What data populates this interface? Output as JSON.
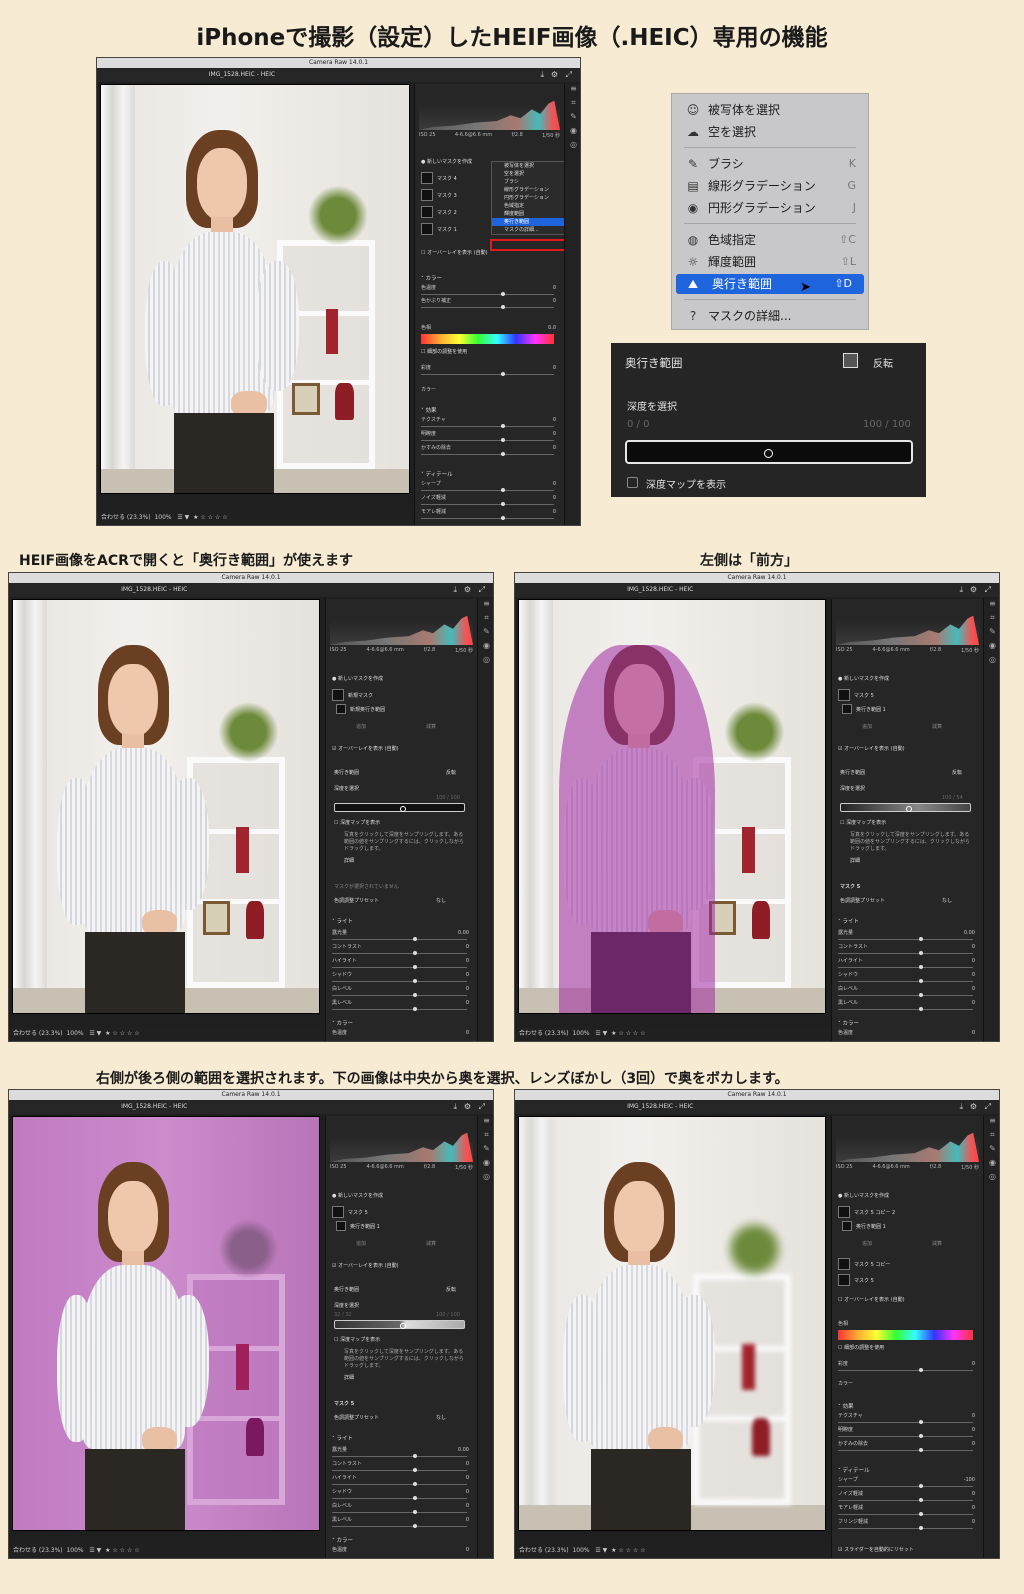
{
  "captions": {
    "title": "iPhoneで撮影（設定）したHEIF画像（.HEIC）専用の機能",
    "left": "HEIF画像をACRで開くと「奥行き範囲」が使えます",
    "right": "左側は「前方」",
    "bottom": "右側が後ろ側の範囲を選択されます。下の画像は中央から奥を選択、レンズぼかし（3回）で奥をボカします。"
  },
  "app": {
    "title": "Camera Raw 14.0.1",
    "filename": "IMG_1528.HEIC  -  HEIC",
    "fit": "合わせる (23.3%)",
    "zoom": "100%"
  },
  "exif": {
    "iso": "ISO 25",
    "lens": "4-6.6@6.6 mm",
    "fstop": "f/2.8",
    "shutter": "1/50 秒"
  },
  "menu": {
    "items": [
      {
        "icon": "person-icon",
        "label": "被写体を選択",
        "shortcut": ""
      },
      {
        "icon": "sky-icon",
        "label": "空を選択",
        "shortcut": ""
      },
      {
        "icon": "brush-icon",
        "label": "ブラシ",
        "shortcut": "K"
      },
      {
        "icon": "linear-gradient-icon",
        "label": "線形グラデーション",
        "shortcut": "G"
      },
      {
        "icon": "radial-gradient-icon",
        "label": "円形グラデーション",
        "shortcut": "J"
      },
      {
        "icon": "color-range-icon",
        "label": "色域指定",
        "shortcut": "⇧C"
      },
      {
        "icon": "luminance-range-icon",
        "label": "輝度範囲",
        "shortcut": "⇧L"
      },
      {
        "icon": "depth-range-icon",
        "label": "奥行き範囲",
        "shortcut": "⇧D"
      },
      {
        "icon": "help-icon",
        "label": "マスクの詳細...",
        "shortcut": ""
      }
    ]
  },
  "depth_panel": {
    "title": "奥行き範囲",
    "invert": "反転",
    "select_label": "深度を選択",
    "min": "0 / 0",
    "max": "100 / 100",
    "show_map": "深度マップを表示"
  },
  "mask_panel": {
    "new_mask": "新しいマスクを作成",
    "masks_top": [
      "マスク 4",
      "マスク 3",
      "マスク 2",
      "マスク 1"
    ],
    "overlay": "オーバーレイを表示 (自動)",
    "add": "追加",
    "subtract": "減算",
    "new_mask_item": "新規マスク",
    "new_depth_item": "新規奥行き範囲",
    "mask5": "マスク 5",
    "depth1": "奥行き範囲 1",
    "mask5_copy2": "マスク 5 コピー 2",
    "mask5_copy": "マスク 5 コピー",
    "depth_hint": "写真をクリックして深度をサンプリングします。ある範囲の値をサンプリングするには、クリックしながらドラッグします。",
    "detail": "詳細",
    "no_mask": "マスクが選択されていません",
    "preset": "色調調整プリセット",
    "preset_val": "なし",
    "depth_range_b": "100 / 54",
    "depth_range_c": "100 / 100",
    "depth_min_c": "32 / 32",
    "reset_sliders": "スライダーを自動的にリセット"
  },
  "sections": {
    "color": "カラー",
    "effects": "効果",
    "detail": "ディテール",
    "light": "ライト"
  },
  "sliders": {
    "color": [
      {
        "label": "色温度",
        "v": "0"
      },
      {
        "label": "色かぶり補正",
        "v": "0"
      }
    ],
    "hue": {
      "label": "色相",
      "v": "0.0"
    },
    "fine": "細部の調整を使用",
    "sat": {
      "label": "彩度",
      "v": "0"
    },
    "col": {
      "label": "カラー"
    },
    "effects": [
      {
        "label": "テクスチャ",
        "v": "0"
      },
      {
        "label": "明瞭度",
        "v": "0"
      },
      {
        "label": "かすみの除去",
        "v": "0"
      }
    ],
    "detail": [
      {
        "label": "シャープ",
        "v": "0"
      },
      {
        "label": "ノイズ軽減",
        "v": "0"
      },
      {
        "label": "モアレ軽減",
        "v": "0"
      }
    ],
    "detail_d": [
      {
        "label": "シャープ",
        "v": "-100"
      },
      {
        "label": "ノイズ軽減",
        "v": "0"
      },
      {
        "label": "モアレ軽減",
        "v": "0"
      },
      {
        "label": "フリンジ軽減",
        "v": "0"
      }
    ],
    "light": [
      {
        "label": "露光量",
        "v": "0.00"
      },
      {
        "label": "コントラスト",
        "v": "0"
      },
      {
        "label": "ハイライト",
        "v": "0"
      },
      {
        "label": "シャドウ",
        "v": "0"
      },
      {
        "label": "白レベル",
        "v": "0"
      },
      {
        "label": "黒レベル",
        "v": "0"
      }
    ],
    "color_temp": {
      "label": "色温度",
      "v": "0"
    }
  },
  "colors": {
    "overlay": "#a028a0",
    "selection": "#1e64dc",
    "highlight": "#e01a1a"
  }
}
